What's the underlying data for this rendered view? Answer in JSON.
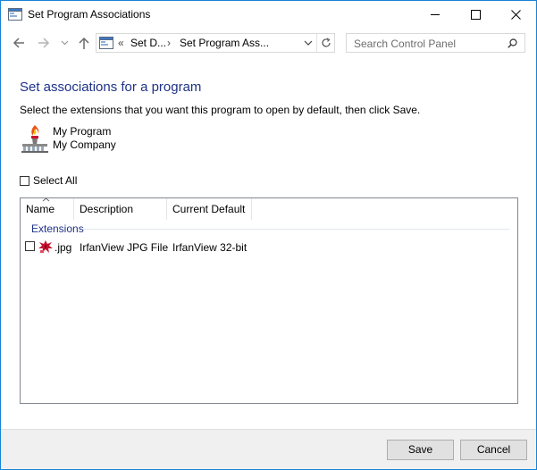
{
  "window": {
    "title": "Set Program Associations",
    "icon": "control-panel-window-icon"
  },
  "title_buttons": {
    "minimize_icon": "minimize-icon",
    "maximize_icon": "maximize-icon",
    "close_icon": "close-icon"
  },
  "nav": {
    "back_icon": "back-arrow-icon",
    "forward_icon": "forward-arrow-icon",
    "recent_icon": "chevron-down-icon",
    "up_icon": "up-arrow-icon"
  },
  "address": {
    "overflow": "«",
    "crumb1": "Set D...",
    "separator": "›",
    "crumb2": "Set Program Ass...",
    "dropdown_icon": "chevron-down-icon",
    "refresh_icon": "refresh-icon"
  },
  "search": {
    "placeholder": "Search Control Panel",
    "icon": "search-icon"
  },
  "content": {
    "heading": "Set associations for a program",
    "instruction": "Select the extensions that you want this program to open by default, then click Save.",
    "program_name": "My Program",
    "program_company": "My Company",
    "select_all_label": "Select All",
    "select_all_checked": false
  },
  "list": {
    "columns": [
      "Name",
      "Description",
      "Current Default"
    ],
    "sort_column": "Name",
    "group": "Extensions",
    "rows": [
      {
        "name": ".jpg",
        "description": "IrfanView JPG File",
        "current_default": "IrfanView 32-bit",
        "checked": false,
        "icon": "irfanview-file-icon"
      }
    ]
  },
  "footer": {
    "save_label": "Save",
    "cancel_label": "Cancel"
  },
  "colors": {
    "heading": "#1e3287",
    "window_border": "#1883d7",
    "footer_bg": "#f0f0f0",
    "button_bg": "#e1e1e1"
  }
}
